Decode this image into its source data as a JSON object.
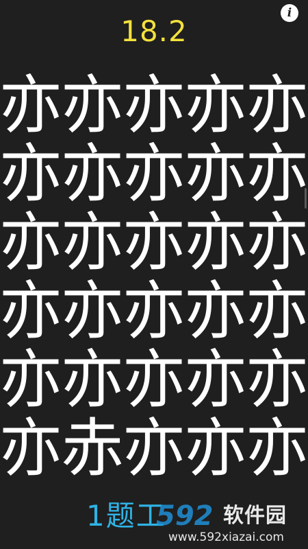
{
  "game": {
    "timer": "18.2",
    "info_icon": "i",
    "level_label": "1题工",
    "grid_chars": [
      [
        "亦",
        "亦",
        "亦",
        "亦",
        "亦"
      ],
      [
        "亦",
        "亦",
        "亦",
        "亦",
        "亦"
      ],
      [
        "亦",
        "亦",
        "亦",
        "亦",
        "亦"
      ],
      [
        "亦",
        "亦",
        "亦",
        "亦",
        "亦"
      ],
      [
        "亦",
        "亦",
        "亦",
        "亦",
        "亦"
      ],
      [
        "亦",
        "赤",
        "亦",
        "亦",
        "亦"
      ]
    ]
  },
  "watermark": {
    "logo_text": "592",
    "name": "软件园",
    "url": "www.592xiazai.com"
  },
  "colors": {
    "background": "#1f1f1f",
    "timer": "#f4e13c",
    "char": "#ffffff",
    "level": "#2fb3e6",
    "watermark_logo": "#1f8fd6",
    "watermark_text": "#ffffff"
  },
  "icons": {
    "info": "info-icon"
  }
}
